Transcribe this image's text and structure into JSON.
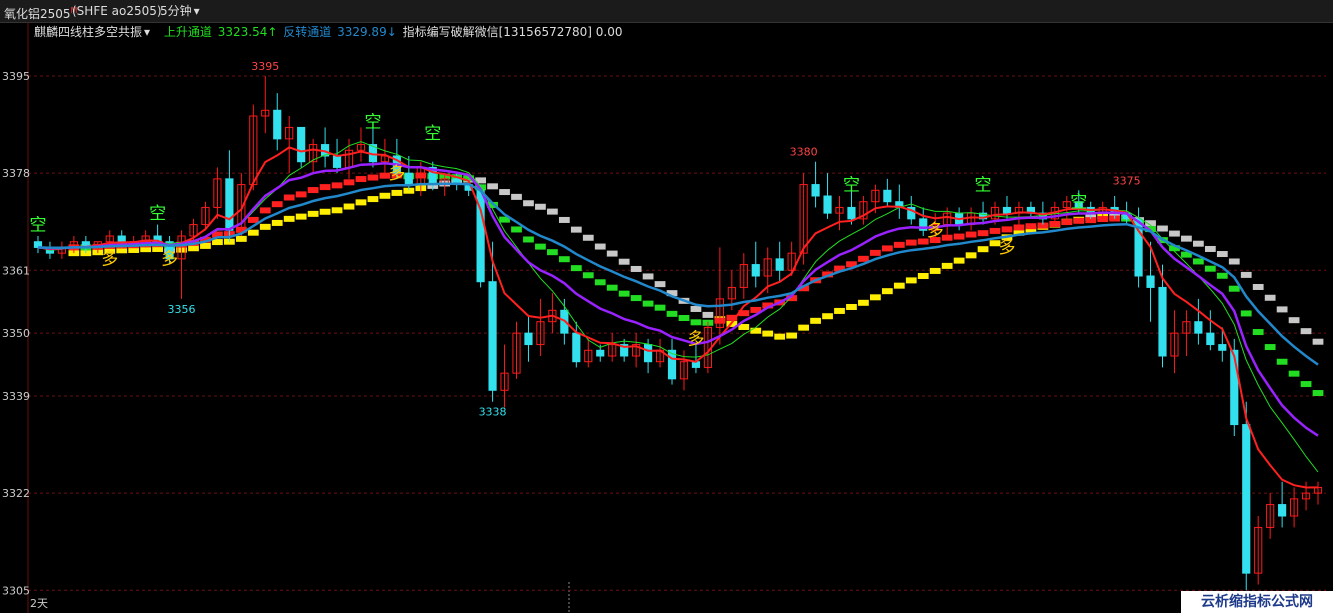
{
  "titlebar": {
    "symbol": "氧化铝2505",
    "badge": "M",
    "code": "(SHFE ao2505)",
    "period": "5分钟",
    "chevron": "▾"
  },
  "indicator": {
    "name": "麒麟四线柱多空共振",
    "chevron": "▾",
    "up_label": "上升通道",
    "up_value": "3323.54",
    "up_arrow": "↑",
    "rev_label": "反转通道",
    "rev_value": "3329.89",
    "rev_arrow": "↓",
    "note": "指标编写破解微信[13156572780] 0.00"
  },
  "footer": {
    "days": "2天",
    "watermark": "云析缩指标公式网"
  },
  "colors": {
    "up": "#ff1a1a",
    "down": "#33e0ee",
    "green": "#22dd22",
    "gray": "#c8c8c8",
    "yellow": "#ffee00",
    "purple": "#9922ff",
    "blue": "#2288cc",
    "red_line": "#ff2020",
    "signal_kong": "#33ff33",
    "signal_duo": "#ffcc00",
    "grid": "#6a1010"
  },
  "chart_data": {
    "type": "candlestick",
    "y_ticks": [
      3395,
      3378,
      3361,
      3350,
      3339,
      3322,
      3305
    ],
    "ylim": [
      3304,
      3402
    ],
    "grid": true,
    "bars": [
      [
        3366,
        3367,
        3364,
        3365
      ],
      [
        3365,
        3366,
        3363,
        3364
      ],
      [
        3364,
        3366,
        3363,
        3365
      ],
      [
        3365,
        3367,
        3364,
        3366
      ],
      [
        3366,
        3367,
        3364,
        3365
      ],
      [
        3365,
        3366,
        3364,
        3366
      ],
      [
        3366,
        3368,
        3365,
        3367
      ],
      [
        3367,
        3368,
        3365,
        3366
      ],
      [
        3366,
        3367,
        3365,
        3366
      ],
      [
        3366,
        3368,
        3365,
        3367
      ],
      [
        3367,
        3369,
        3366,
        3366
      ],
      [
        3366,
        3367,
        3362,
        3363
      ],
      [
        3363,
        3368,
        3356,
        3367
      ],
      [
        3367,
        3370,
        3366,
        3369
      ],
      [
        3369,
        3373,
        3368,
        3372
      ],
      [
        3372,
        3379,
        3370,
        3377
      ],
      [
        3377,
        3382,
        3366,
        3368
      ],
      [
        3368,
        3378,
        3367,
        3376
      ],
      [
        3376,
        3390,
        3375,
        3388
      ],
      [
        3388,
        3395,
        3385,
        3389
      ],
      [
        3389,
        3392,
        3382,
        3384
      ],
      [
        3384,
        3388,
        3378,
        3386
      ],
      [
        3386,
        3386,
        3379,
        3380
      ],
      [
        3380,
        3384,
        3378,
        3383
      ],
      [
        3383,
        3386,
        3379,
        3381
      ],
      [
        3381,
        3384,
        3378,
        3379
      ],
      [
        3379,
        3384,
        3377,
        3382
      ],
      [
        3382,
        3386,
        3380,
        3383
      ],
      [
        3383,
        3387,
        3379,
        3380
      ],
      [
        3380,
        3384,
        3378,
        3381
      ],
      [
        3381,
        3384,
        3377,
        3378
      ],
      [
        3378,
        3381,
        3375,
        3376
      ],
      [
        3376,
        3380,
        3374,
        3379
      ],
      [
        3379,
        3380,
        3375,
        3376
      ],
      [
        3376,
        3378,
        3374,
        3377
      ],
      [
        3377,
        3378,
        3375,
        3376
      ],
      [
        3376,
        3377,
        3374,
        3375
      ],
      [
        3375,
        3376,
        3358,
        3359
      ],
      [
        3359,
        3366,
        3338,
        3340
      ],
      [
        3340,
        3348,
        3337,
        3343
      ],
      [
        3343,
        3352,
        3342,
        3350
      ],
      [
        3350,
        3353,
        3345,
        3348
      ],
      [
        3348,
        3356,
        3346,
        3352
      ],
      [
        3352,
        3357,
        3350,
        3354
      ],
      [
        3354,
        3356,
        3348,
        3350
      ],
      [
        3350,
        3352,
        3344,
        3345
      ],
      [
        3345,
        3349,
        3344,
        3347
      ],
      [
        3347,
        3348,
        3345,
        3346
      ],
      [
        3346,
        3350,
        3345,
        3348
      ],
      [
        3348,
        3349,
        3345,
        3346
      ],
      [
        3346,
        3350,
        3344,
        3348
      ],
      [
        3348,
        3349,
        3343,
        3345
      ],
      [
        3345,
        3349,
        3344,
        3347
      ],
      [
        3347,
        3349,
        3341,
        3342
      ],
      [
        3342,
        3347,
        3340,
        3345
      ],
      [
        3345,
        3348,
        3343,
        3344
      ],
      [
        3344,
        3352,
        3343,
        3351
      ],
      [
        3351,
        3365,
        3348,
        3356
      ],
      [
        3356,
        3361,
        3354,
        3358
      ],
      [
        3358,
        3364,
        3356,
        3362
      ],
      [
        3362,
        3366,
        3358,
        3360
      ],
      [
        3360,
        3365,
        3357,
        3363
      ],
      [
        3363,
        3366,
        3359,
        3361
      ],
      [
        3361,
        3366,
        3360,
        3364
      ],
      [
        3364,
        3378,
        3362,
        3376
      ],
      [
        3376,
        3380,
        3372,
        3374
      ],
      [
        3374,
        3378,
        3370,
        3371
      ],
      [
        3371,
        3374,
        3368,
        3372
      ],
      [
        3372,
        3375,
        3369,
        3370
      ],
      [
        3370,
        3374,
        3369,
        3373
      ],
      [
        3373,
        3376,
        3371,
        3375
      ],
      [
        3375,
        3377,
        3372,
        3373
      ],
      [
        3373,
        3376,
        3370,
        3372
      ],
      [
        3372,
        3374,
        3369,
        3370
      ],
      [
        3370,
        3372,
        3367,
        3368
      ],
      [
        3368,
        3371,
        3366,
        3369
      ],
      [
        3369,
        3372,
        3367,
        3371
      ],
      [
        3371,
        3372,
        3368,
        3369
      ],
      [
        3369,
        3372,
        3368,
        3371
      ],
      [
        3371,
        3373,
        3369,
        3370
      ],
      [
        3370,
        3373,
        3369,
        3372
      ],
      [
        3372,
        3374,
        3370,
        3371
      ],
      [
        3371,
        3373,
        3369,
        3372
      ],
      [
        3372,
        3373,
        3370,
        3371
      ],
      [
        3371,
        3373,
        3369,
        3370
      ],
      [
        3370,
        3373,
        3369,
        3372
      ],
      [
        3372,
        3374,
        3370,
        3373
      ],
      [
        3373,
        3375,
        3371,
        3372
      ],
      [
        3372,
        3373,
        3370,
        3371
      ],
      [
        3371,
        3373,
        3370,
        3372
      ],
      [
        3372,
        3374,
        3370,
        3371
      ],
      [
        3371,
        3373,
        3369,
        3370
      ],
      [
        3370,
        3372,
        3358,
        3360
      ],
      [
        3360,
        3366,
        3352,
        3358
      ],
      [
        3358,
        3362,
        3344,
        3346
      ],
      [
        3346,
        3354,
        3343,
        3350
      ],
      [
        3350,
        3354,
        3346,
        3352
      ],
      [
        3352,
        3356,
        3348,
        3350
      ],
      [
        3350,
        3354,
        3347,
        3348
      ],
      [
        3348,
        3351,
        3345,
        3347
      ],
      [
        3347,
        3349,
        3332,
        3334
      ],
      [
        3334,
        3338,
        3305,
        3308
      ],
      [
        3308,
        3318,
        3306,
        3316
      ],
      [
        3316,
        3322,
        3314,
        3320
      ],
      [
        3320,
        3324,
        3316,
        3318
      ],
      [
        3318,
        3323,
        3316,
        3321
      ],
      [
        3321,
        3324,
        3319,
        3322
      ],
      [
        3322,
        3324,
        3320,
        3323
      ]
    ],
    "labels": [
      {
        "text": "3395",
        "i": 19,
        "v": 3395,
        "pos": "top"
      },
      {
        "text": "3356",
        "i": 12,
        "v": 3356,
        "pos": "bottom"
      },
      {
        "text": "3338",
        "i": 38,
        "v": 3338,
        "pos": "bottom"
      },
      {
        "text": "3380",
        "i": 64,
        "v": 3380,
        "pos": "top"
      },
      {
        "text": "3375",
        "i": 91,
        "v": 3375,
        "pos": "top"
      },
      {
        "text": "3305",
        "i": 101,
        "v": 3305,
        "pos": "bottom"
      }
    ],
    "signals": [
      {
        "text": "空",
        "i": 0,
        "v": 3368,
        "kind": "kong"
      },
      {
        "text": "多",
        "i": 6,
        "v": 3362,
        "kind": "duo"
      },
      {
        "text": "空",
        "i": 10,
        "v": 3370,
        "kind": "kong"
      },
      {
        "text": "多",
        "i": 11,
        "v": 3362,
        "kind": "duo"
      },
      {
        "text": "空",
        "i": 28,
        "v": 3386,
        "kind": "kong"
      },
      {
        "text": "多",
        "i": 30,
        "v": 3377,
        "kind": "duo"
      },
      {
        "text": "空",
        "i": 33,
        "v": 3384,
        "kind": "kong"
      },
      {
        "text": "多",
        "i": 55,
        "v": 3348,
        "kind": "duo"
      },
      {
        "text": "空",
        "i": 68,
        "v": 3375,
        "kind": "kong"
      },
      {
        "text": "多",
        "i": 75,
        "v": 3367,
        "kind": "duo"
      },
      {
        "text": "空",
        "i": 79,
        "v": 3375,
        "kind": "kong"
      },
      {
        "text": "多",
        "i": 81,
        "v": 3364,
        "kind": "duo"
      },
      {
        "text": "空",
        "i": 87,
        "v": 3372,
        "kind": "kong"
      }
    ]
  }
}
